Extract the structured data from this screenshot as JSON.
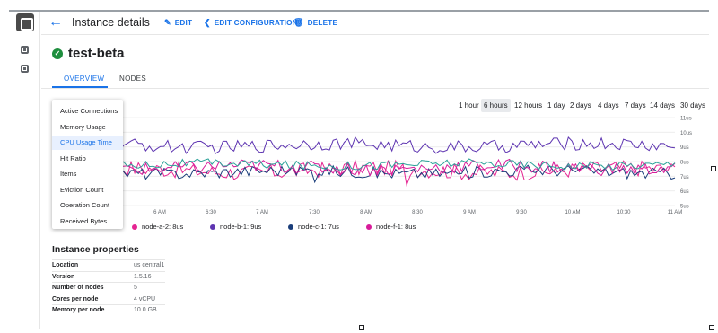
{
  "header": {
    "title": "Instance details",
    "edit_label": "EDIT",
    "edit_config_label": "EDIT CONFIGURATION",
    "delete_label": "DELETE"
  },
  "instance": {
    "name": "test-beta",
    "status_icon": "check-circle-icon",
    "status_color": "#1e8e3e"
  },
  "tabs": [
    {
      "label": "OVERVIEW",
      "active": true
    },
    {
      "label": "NODES",
      "active": false
    }
  ],
  "time_ranges": [
    {
      "label": "1 hour",
      "selected": false
    },
    {
      "label": "6 hours",
      "selected": true
    },
    {
      "label": "12 hours",
      "selected": false
    },
    {
      "label": "1 day",
      "selected": false
    },
    {
      "label": "2 days",
      "selected": false
    },
    {
      "label": "4 days",
      "selected": false
    },
    {
      "label": "7 days",
      "selected": false
    },
    {
      "label": "14 days",
      "selected": false
    },
    {
      "label": "30 days",
      "selected": false
    }
  ],
  "metric_menu": {
    "items": [
      "Active Connections",
      "Memory Usage",
      "CPU Usage Time",
      "Hit Ratio",
      "Items",
      "Eviction Count",
      "Operation Count",
      "Received Bytes"
    ],
    "selected_index": 2
  },
  "chart_data": {
    "type": "line",
    "x_ticks": [
      "6 AM",
      "6:30",
      "7 AM",
      "7:30",
      "8 AM",
      "8:30",
      "9 AM",
      "9:30",
      "10 AM",
      "10:30",
      "11 AM"
    ],
    "y_ticks": [
      "11us",
      "10us",
      "9us",
      "8us",
      "7us",
      "6us",
      "5us"
    ],
    "ylim": [
      5,
      11
    ],
    "series": [
      {
        "name": "node-a-2: 8us",
        "color": "#e52592",
        "base": 7.4,
        "amp": 0.55
      },
      {
        "name": "node-b-1: 9us",
        "color": "#5e35b1",
        "base": 9.1,
        "amp": 0.45
      },
      {
        "name": "node-c-1: 7us",
        "color": "#1a3d7a",
        "base": 7.3,
        "amp": 0.4
      },
      {
        "name": "node-f-1: 8us",
        "color": "#d81b9a",
        "base": 7.6,
        "amp": 0.45
      },
      {
        "name": "",
        "color": "#2aa198",
        "base": 7.8,
        "amp": 0.3
      }
    ]
  },
  "legend": [
    {
      "label": "node-a-2: 8us",
      "color": "#e52592"
    },
    {
      "label": "node-b-1: 9us",
      "color": "#5e35b1"
    },
    {
      "label": "node-c-1: 7us",
      "color": "#1a3d7a"
    },
    {
      "label": "node-f-1: 8us",
      "color": "#d81b9a"
    }
  ],
  "properties": {
    "title": "Instance properties",
    "rows": [
      {
        "key": "Location",
        "value": "us central1"
      },
      {
        "key": "Version",
        "value": "1.5.16"
      },
      {
        "key": "Number of nodes",
        "value": "5"
      },
      {
        "key": "Cores per node",
        "value": "4 vCPU"
      },
      {
        "key": "Memory per node",
        "value": "10.0 GB"
      }
    ]
  }
}
